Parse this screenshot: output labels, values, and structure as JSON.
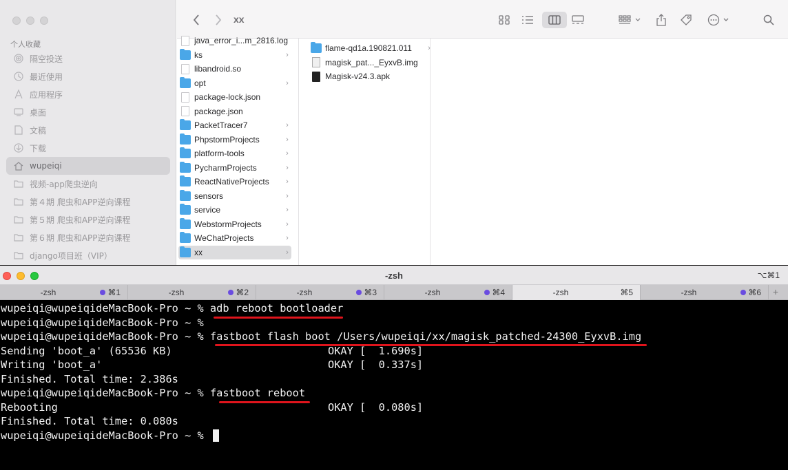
{
  "finder": {
    "title": "xx",
    "sidebar": {
      "heading": "个人收藏",
      "items": [
        {
          "label": "隔空投送",
          "icon": "airdrop-icon"
        },
        {
          "label": "最近使用",
          "icon": "clock-icon"
        },
        {
          "label": "应用程序",
          "icon": "applications-icon"
        },
        {
          "label": "桌面",
          "icon": "desktop-icon"
        },
        {
          "label": "文稿",
          "icon": "document-icon"
        },
        {
          "label": "下载",
          "icon": "download-icon"
        },
        {
          "label": "wupeiqi",
          "icon": "home-icon"
        },
        {
          "label": "视频-app爬虫逆向",
          "icon": "folder-icon"
        },
        {
          "label": "第４期 爬虫和APP逆向课程",
          "icon": "folder-icon"
        },
        {
          "label": "第５期 爬虫和APP逆向课程",
          "icon": "folder-icon"
        },
        {
          "label": "第６期 爬虫和APP逆向课程",
          "icon": "folder-icon"
        },
        {
          "label": "django项目班（VIP）",
          "icon": "folder-icon"
        }
      ]
    },
    "column1": [
      {
        "label": "java_error_i...m_2816.log",
        "type": "file"
      },
      {
        "label": "ks",
        "type": "folder"
      },
      {
        "label": "libandroid.so",
        "type": "file"
      },
      {
        "label": "opt",
        "type": "folder"
      },
      {
        "label": "package-lock.json",
        "type": "file"
      },
      {
        "label": "package.json",
        "type": "file"
      },
      {
        "label": "PacketTracer7",
        "type": "folder"
      },
      {
        "label": "PhpstormProjects",
        "type": "folder"
      },
      {
        "label": "platform-tools",
        "type": "folder"
      },
      {
        "label": "PycharmProjects",
        "type": "folder"
      },
      {
        "label": "ReactNativeProjects",
        "type": "folder"
      },
      {
        "label": "sensors",
        "type": "folder"
      },
      {
        "label": "service",
        "type": "folder"
      },
      {
        "label": "WebstormProjects",
        "type": "folder"
      },
      {
        "label": "WeChatProjects",
        "type": "folder"
      },
      {
        "label": "xx",
        "type": "folder"
      }
    ],
    "column2": [
      {
        "label": "flame-qd1a.190821.011",
        "type": "folder"
      },
      {
        "label": "magisk_pat..._EyxvB.img",
        "type": "img"
      },
      {
        "label": "Magisk-v24.3.apk",
        "type": "apk"
      }
    ]
  },
  "terminal": {
    "title": "-zsh",
    "shortcut": "⌥⌘1",
    "tabs": [
      {
        "name": "-zsh",
        "key": "⌘1"
      },
      {
        "name": "-zsh",
        "key": "⌘2"
      },
      {
        "name": "-zsh",
        "key": "⌘3"
      },
      {
        "name": "-zsh",
        "key": "⌘4"
      },
      {
        "name": "-zsh",
        "key": "⌘5"
      },
      {
        "name": "-zsh",
        "key": "⌘6"
      }
    ],
    "add_tab": "+",
    "lines": [
      "wupeiqi@wupeiqideMacBook-Pro ~ % adb reboot bootloader",
      "wupeiqi@wupeiqideMacBook-Pro ~ %",
      "wupeiqi@wupeiqideMacBook-Pro ~ % fastboot flash boot /Users/wupeiqi/xx/magisk_patched-24300_EyxvB.img",
      "Sending 'boot_a' (65536 KB)",
      "Writing 'boot_a'",
      "Finished. Total time: 2.386s",
      "wupeiqi@wupeiqideMacBook-Pro ~ % fastboot reboot",
      "Rebooting",
      "Finished. Total time: 0.080s",
      "wupeiqi@wupeiqideMacBook-Pro ~ %"
    ],
    "status": {
      "sending": "OKAY [  1.690s]",
      "writing": "OKAY [  0.337s]",
      "rebooting": "OKAY [  0.080s]"
    },
    "highlight_color": "#e0141c"
  }
}
